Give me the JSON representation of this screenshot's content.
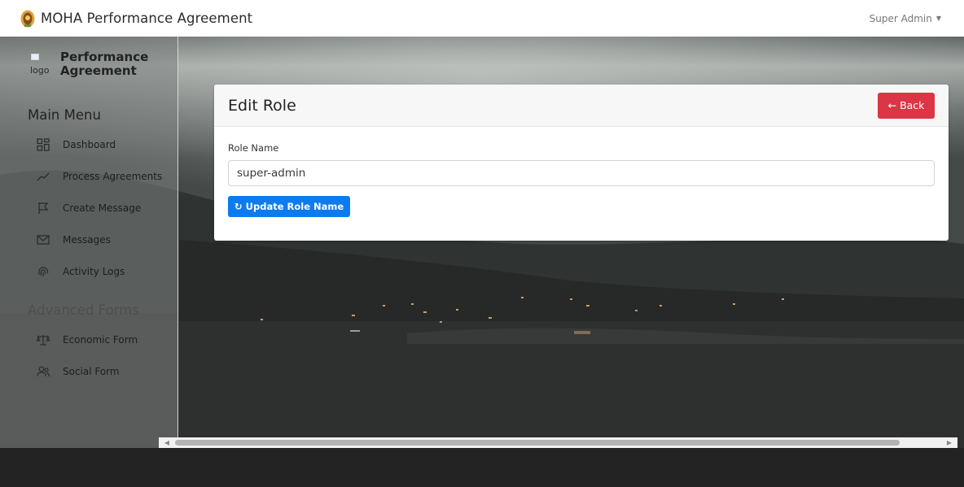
{
  "app": {
    "title": "MOHA Performance Agreement",
    "user_label": "Super Admin"
  },
  "sidebar": {
    "logo_alt": "logo",
    "brand_text": "Performance Agreement",
    "main_menu_heading": "Main Menu",
    "main_items": [
      {
        "label": "Dashboard",
        "icon": "dashboard-grid-icon"
      },
      {
        "label": "Process Agreements",
        "icon": "trend-line-icon"
      },
      {
        "label": "Create Message",
        "icon": "flag-icon"
      },
      {
        "label": "Messages",
        "icon": "envelope-icon"
      },
      {
        "label": "Activity Logs",
        "icon": "fingerprint-icon"
      }
    ],
    "advanced_heading": "Advanced Forms",
    "advanced_items": [
      {
        "label": "Economic Form",
        "icon": "scale-icon"
      },
      {
        "label": "Social Form",
        "icon": "users-icon"
      }
    ]
  },
  "card": {
    "title": "Edit Role",
    "back_label": "Back",
    "field_label": "Role Name",
    "field_value": "super-admin",
    "update_label": "Update Role Name"
  },
  "colors": {
    "danger": "#dc3545",
    "primary": "#0d7bf0"
  }
}
